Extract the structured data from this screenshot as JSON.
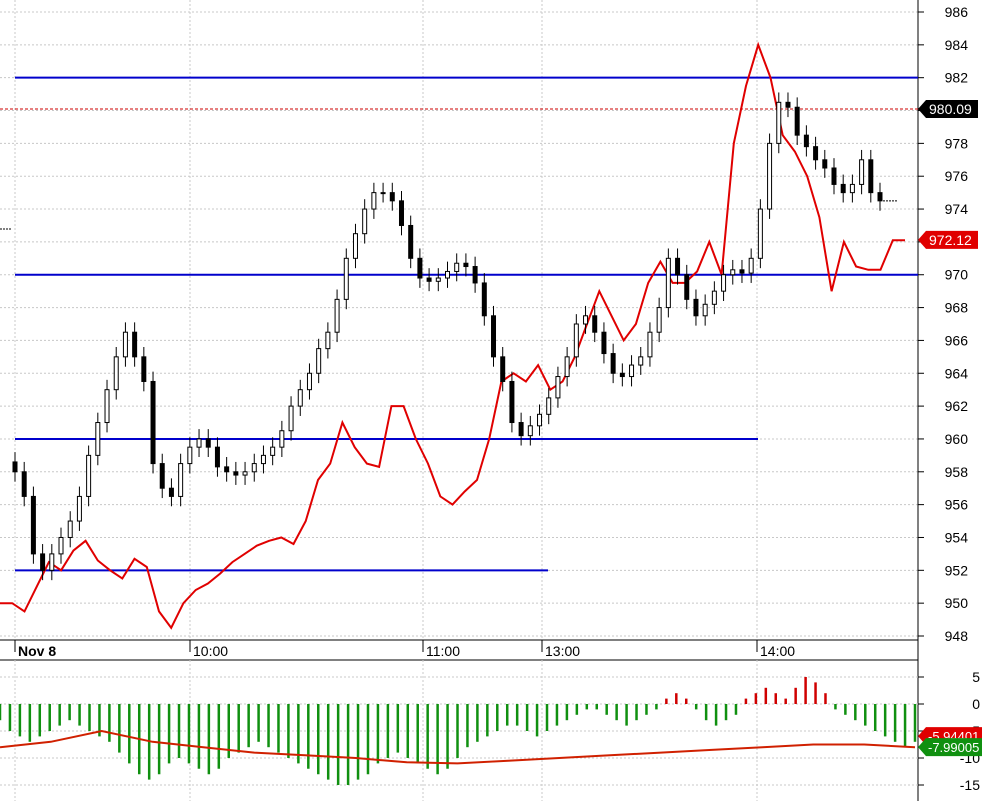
{
  "chart_data": [
    {
      "type": "candlestick",
      "panel": "price",
      "ylim": [
        947,
        987
      ],
      "y_ticks": [
        948,
        950,
        952,
        954,
        956,
        958,
        960,
        962,
        964,
        966,
        968,
        970,
        972,
        974,
        976,
        978,
        980,
        982,
        984,
        986
      ],
      "x_tick_labels": [
        "Nov 8",
        "10:00",
        "11:00",
        "13:00",
        "14:00"
      ],
      "horizontal_levels": [
        {
          "value": 982,
          "color": "#0000cc"
        },
        {
          "value": 970,
          "color": "#0000cc"
        },
        {
          "value": 960,
          "color": "#0000cc"
        },
        {
          "value": 952,
          "color": "#0000cc"
        }
      ],
      "reference_line": {
        "value": 980.09,
        "style": "dashed",
        "color": "#cc0000"
      },
      "price_flags": [
        {
          "label": "980.09",
          "value": 980.09,
          "color": "#000000"
        },
        {
          "label": "972.12",
          "value": 972.12,
          "color": "#e00000"
        }
      ],
      "close_series": [
        958,
        956.5,
        953,
        952,
        953,
        954,
        955,
        956.5,
        959,
        961,
        963,
        965,
        966.5,
        965,
        963.5,
        958.5,
        957,
        956.5,
        958.5,
        959.5,
        960,
        959.5,
        958.3,
        958,
        957.8,
        958,
        958.5,
        959,
        959.5,
        960.5,
        962,
        963,
        964,
        965.5,
        966.5,
        968.5,
        971,
        972.5,
        974,
        975,
        975,
        974.5,
        973,
        971,
        969.8,
        969.6,
        969.8,
        970.2,
        970.7,
        970.5,
        969.5,
        967.5,
        965,
        963.5,
        961,
        960.2,
        960.8,
        961.5,
        962.5,
        963.8,
        965,
        967,
        967.5,
        966.5,
        965.2,
        964,
        963.8,
        964.5,
        965,
        966.5,
        968,
        971,
        970,
        968.5,
        967.5,
        968.2,
        969,
        970,
        970.3,
        970.1,
        971,
        974,
        978,
        980.5,
        980.2,
        978.5,
        977.8,
        977,
        976.5,
        975.5,
        975,
        975.5,
        977,
        975,
        974.5
      ],
      "comparison_series": {
        "color": "#e00000",
        "values": [
          950,
          950,
          949.5,
          951,
          952.5,
          952,
          953.2,
          953.8,
          952.6,
          952,
          951.5,
          952.7,
          952.2,
          949.5,
          948.5,
          950,
          950.8,
          951.2,
          951.8,
          952.5,
          953,
          953.5,
          953.8,
          954,
          953.6,
          955,
          957.5,
          958.5,
          961,
          959.5,
          958.5,
          958.3,
          962,
          962,
          960,
          958.5,
          956.5,
          956,
          956.8,
          957.5,
          960,
          963.5,
          964,
          963.5,
          964.5,
          963,
          963.5,
          965,
          967,
          969,
          967.5,
          966,
          967,
          969.5,
          970.8,
          969.5,
          969.5,
          970.2,
          972,
          970,
          978,
          981.5,
          984,
          982,
          978.5,
          977.5,
          976,
          973.5,
          969,
          972,
          970.5,
          970.3,
          970.3,
          972.1,
          972.1
        ]
      }
    },
    {
      "type": "histogram",
      "panel": "oscillator",
      "ylim": [
        -16,
        7
      ],
      "y_ticks": [
        5,
        0,
        -5,
        -10,
        -15
      ],
      "y_tick_labels": [
        "5",
        "0",
        "-5",
        "-10",
        "-15"
      ],
      "value_flags": [
        {
          "label": "-5.94401",
          "value": -5.94401,
          "color": "#e00000"
        },
        {
          "label": "-7.99005",
          "value": -7.99005,
          "color": "#109010"
        }
      ],
      "bars": [
        -3,
        -5,
        -6,
        -7,
        -6,
        -5,
        -4,
        -3,
        -4,
        -5,
        -6,
        -7,
        -9,
        -11,
        -13,
        -14,
        -13,
        -11,
        -10,
        -11,
        -12,
        -13,
        -12,
        -10,
        -9,
        -8,
        -7,
        -8,
        -9,
        -10,
        -11,
        -12,
        -13,
        -14,
        -15,
        -15,
        -14,
        -13,
        -11,
        -10,
        -9,
        -10,
        -11,
        -12,
        -13,
        -12,
        -10,
        -8,
        -7,
        -6,
        -5,
        -4,
        -4,
        -5,
        -6,
        -5,
        -4,
        -3,
        -2,
        -1,
        -1,
        -2,
        -3,
        -4,
        -3,
        -2,
        -1,
        1,
        2,
        1,
        -1,
        -3,
        -4,
        -3,
        -2,
        1,
        2,
        3,
        2,
        1,
        3,
        5,
        4,
        2,
        -1,
        -2,
        -3,
        -4,
        -5,
        -6,
        -7,
        -8,
        -7
      ],
      "signal_line": {
        "color": "#d02000",
        "values": [
          -8,
          -7,
          -5,
          -7,
          -8,
          -9,
          -9.5,
          -10,
          -10.8,
          -11,
          -10.5,
          -10,
          -9.5,
          -9,
          -8.5,
          -8,
          -7.5,
          -7.5,
          -8
        ]
      }
    }
  ]
}
